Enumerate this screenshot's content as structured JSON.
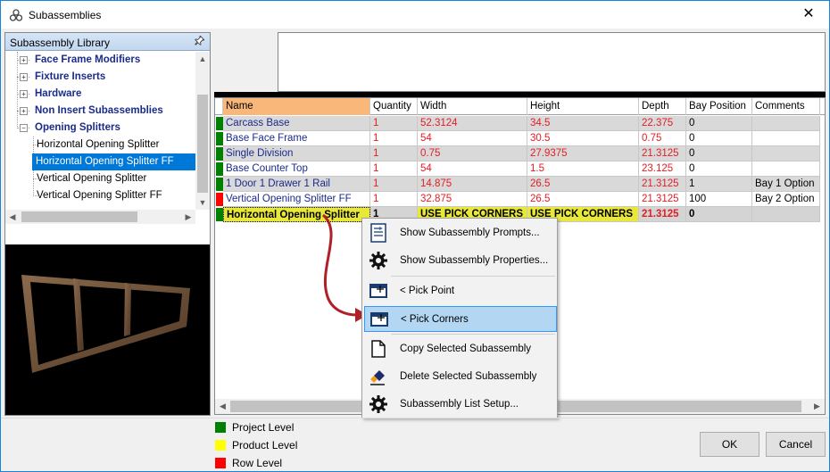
{
  "window": {
    "title": "Subassemblies",
    "close": "✕"
  },
  "library": {
    "header": "Subassembly Library",
    "tree": [
      {
        "label": "Face Frame Modifiers",
        "bold": true,
        "expander": "+"
      },
      {
        "label": "Fixture Inserts",
        "bold": true,
        "expander": "+"
      },
      {
        "label": "Hardware",
        "bold": true,
        "expander": "+"
      },
      {
        "label": "Non Insert Subassemblies",
        "bold": true,
        "expander": "+"
      },
      {
        "label": "Opening Splitters",
        "bold": true,
        "expander": "−"
      },
      {
        "label": "Horizontal Opening Splitter",
        "bold": false
      },
      {
        "label": "Horizontal Opening Splitter FF",
        "bold": false,
        "selected": true
      },
      {
        "label": "Vertical Opening Splitter",
        "bold": false
      },
      {
        "label": "Vertical Opening Splitter FF",
        "bold": false
      }
    ]
  },
  "grid": {
    "columns": [
      "Name",
      "Quantity",
      "Width",
      "Height",
      "Depth",
      "Bay Position",
      "Comments"
    ],
    "rows": [
      {
        "level": "green",
        "shaded": true,
        "cells": [
          "Carcass Base",
          "1",
          "52.3124",
          "34.5",
          "22.375",
          "0",
          ""
        ]
      },
      {
        "level": "green",
        "shaded": false,
        "cells": [
          "Base Face Frame",
          "1",
          "54",
          "30.5",
          "0.75",
          "0",
          ""
        ]
      },
      {
        "level": "green",
        "shaded": true,
        "cells": [
          "Single Division",
          "1",
          "0.75",
          "27.9375",
          "21.3125",
          "0",
          ""
        ]
      },
      {
        "level": "green",
        "shaded": false,
        "cells": [
          "Base Counter Top",
          "1",
          "54",
          "1.5",
          "23.125",
          "0",
          ""
        ]
      },
      {
        "level": "green",
        "shaded": true,
        "cells": [
          "1 Door 1 Drawer 1 Rail",
          "1",
          "14.875",
          "26.5",
          "21.3125",
          "1",
          "Bay 1 Option"
        ]
      },
      {
        "level": "red",
        "shaded": false,
        "cells": [
          "Vertical Opening Splitter FF",
          "1",
          "32.875",
          "26.5",
          "21.3125",
          "100",
          "Bay 2 Option"
        ]
      },
      {
        "level": "green",
        "highlight": true,
        "cells": [
          "Horizontal Opening Splitter",
          "1",
          "USE PICK CORNERS",
          "USE PICK CORNERS",
          "21.3125",
          "0",
          ""
        ]
      }
    ]
  },
  "context_menu": {
    "items": [
      {
        "label": "Show Subassembly Prompts...",
        "icon": "prompts-icon"
      },
      {
        "label": "Show Subassembly Properties...",
        "icon": "gear-icon"
      },
      {
        "label": "< Pick Point",
        "icon": "pick-point-icon"
      },
      {
        "label": "< Pick Corners",
        "icon": "pick-corners-icon",
        "active": true
      },
      {
        "label": "Copy Selected Subassembly",
        "icon": "copy-icon"
      },
      {
        "label": "Delete Selected Subassembly",
        "icon": "eraser-icon"
      },
      {
        "label": "Subassembly List Setup...",
        "icon": "gear-icon"
      }
    ]
  },
  "legend": [
    {
      "label": "Project Level",
      "color": "#008000"
    },
    {
      "label": "Product Level",
      "color": "#ffff00"
    },
    {
      "label": "Row Level",
      "color": "#ff0000"
    }
  ],
  "buttons": {
    "ok": "OK",
    "cancel": "Cancel"
  },
  "colors": {
    "level_green": "#008000",
    "level_red": "#ff0000",
    "highlight_yellow": "#e8e83a",
    "selection": "#0078d7"
  }
}
